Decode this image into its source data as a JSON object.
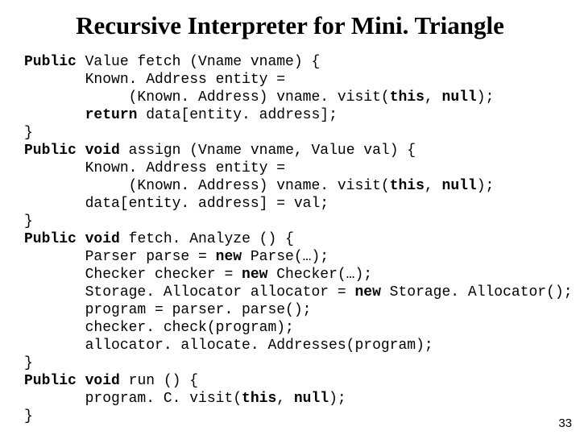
{
  "title": "Recursive Interpreter for Mini. Triangle",
  "page_number": "33",
  "code": {
    "l01a": "Public",
    "l01b": " Value fetch (Vname vname) {",
    "l02": "       Known. Address entity =",
    "l03a": "            (Known. Address) vname. visit(",
    "l03b": "this",
    "l03c": ", ",
    "l03d": "null",
    "l03e": ");",
    "l04a": "       ",
    "l04b": "return",
    "l04c": " data[entity. address];",
    "l05": "}",
    "l06a": "Public",
    "l06b": " ",
    "l06c": "void",
    "l06d": " assign (Vname vname, Value val) {",
    "l07": "       Known. Address entity =",
    "l08a": "            (Known. Address) vname. visit(",
    "l08b": "this",
    "l08c": ", ",
    "l08d": "null",
    "l08e": ");",
    "l09": "       data[entity. address] = val;",
    "l10": "}",
    "l11a": "Public",
    "l11b": " ",
    "l11c": "void",
    "l11d": " fetch. Analyze () {",
    "l12a": "       Parser parse = ",
    "l12b": "new",
    "l12c": " Parse(…);",
    "l13a": "       Checker checker = ",
    "l13b": "new",
    "l13c": " Checker(…);",
    "l14a": "       Storage. Allocator allocator = ",
    "l14b": "new",
    "l14c": " Storage. Allocator();",
    "l15": "       program = parser. parse();",
    "l16": "       checker. check(program);",
    "l17": "       allocator. allocate. Addresses(program);",
    "l18": "}",
    "l19a": "Public",
    "l19b": " ",
    "l19c": "void",
    "l19d": " run () {",
    "l20a": "       program. C. visit(",
    "l20b": "this",
    "l20c": ", ",
    "l20d": "null",
    "l20e": ");",
    "l21": "}"
  }
}
